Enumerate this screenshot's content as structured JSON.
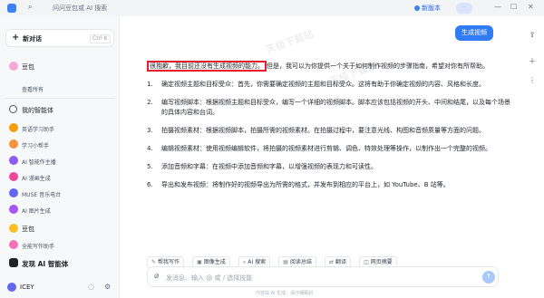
{
  "titlebar": {
    "search_placeholder": "问问豆包或 AI 搜索",
    "new_version": "新版本",
    "user_badge": "·",
    "controls": [
      "—",
      "☐",
      "✕"
    ]
  },
  "sidebar": {
    "new_chat_label": "新对话",
    "new_chat_shortcut": "Ctrl K",
    "doubao_label": "豆包",
    "view_all": "查看所有",
    "my_agents_label": "我的智能体",
    "agents": [
      {
        "label": "英语学习助手",
        "color": "#f59e0b"
      },
      {
        "label": "学习小帮手",
        "color": "#fb923c"
      },
      {
        "label": "AI 智能作主播",
        "color": "#8b5cf6"
      },
      {
        "label": "AI 漫画生成",
        "color": "#ec4899"
      },
      {
        "label": "MUSE 音乐电台",
        "color": "#6366f1"
      },
      {
        "label": "AI 图片生成",
        "color": "#a855f7"
      }
    ],
    "doubao2_label": "豆包",
    "all_purpose": "全能写作助手",
    "discover_label": "发现 AI 智能体",
    "user_name": "ICEY"
  },
  "chat": {
    "user_message": "生成视频",
    "intro_highlight": "很抱歉，我目前还没有生成视频的能力。",
    "intro_rest": "但是，我可以为你提供一个关于如何制作视频的步骤指南，希望对你有所帮助。",
    "steps": [
      {
        "num": "1.",
        "text": "确定视频主题和目标受众：首先，你需要确定视频的主题和目标受众。这将有助于你确定视频的内容、风格和长度。"
      },
      {
        "num": "2.",
        "text": "编写视频脚本：根据视频主题和目标受众，编写一个详细的视频脚本。脚本应该包括视频的开头、中间和结尾，以及每个场景的具体内容和台词。"
      },
      {
        "num": "3.",
        "text": "拍摄视频素材：根据视频脚本，拍摄所需的视频素材。在拍摄过程中，要注意光线、构图和音频质量等方面的问题。"
      },
      {
        "num": "4.",
        "text": "编辑视频素材：使用视频编辑软件，将拍摄的视频素材进行剪辑、调色、特效处理等操作，以制作出一个完整的视频。"
      },
      {
        "num": "5.",
        "text": "添加音频和字幕：在视频中添加音频和字幕，以增强视频的表现力和可读性。"
      },
      {
        "num": "6.",
        "text": "导出和发布视频：将制作好的视频导出为所需的格式，并发布到相应的平台上，如 YouTube、B 站等。"
      }
    ]
  },
  "quick_actions": [
    {
      "label": "帮我写作",
      "icon": "pen-icon",
      "glyph": "✎"
    },
    {
      "label": "图像生成",
      "icon": "image-icon",
      "glyph": "▣"
    },
    {
      "label": "AI 搜索",
      "icon": "search-icon",
      "glyph": "⌕"
    },
    {
      "label": "阅读总结",
      "icon": "book-icon",
      "glyph": "▤"
    },
    {
      "label": "翻译",
      "icon": "translate-icon",
      "glyph": "⇄"
    },
    {
      "label": "网页摘要",
      "icon": "web-icon",
      "glyph": "◫"
    }
  ],
  "input": {
    "placeholder": "发消息、输入 @ 或 / 选择技能"
  },
  "footer_note": "内容由 AI 生成，请仔细甄别",
  "watermark": "天极下载站",
  "colors": {
    "accent": "#2f7cf6",
    "highlight_border": "#e11d2e"
  }
}
